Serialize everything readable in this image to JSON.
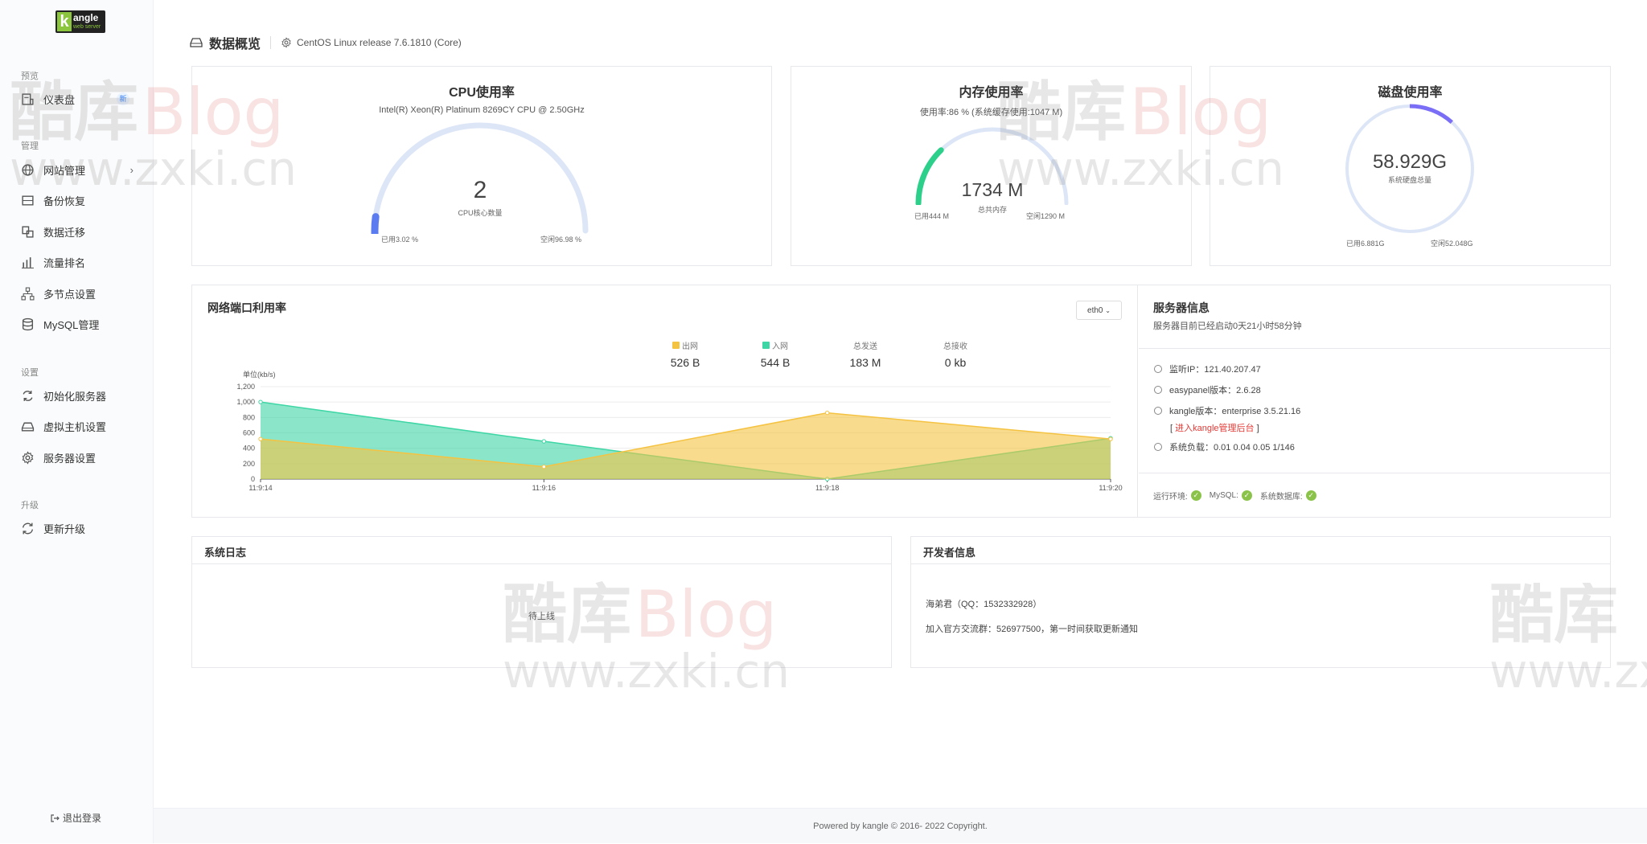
{
  "sidebar": {
    "sections": [
      {
        "title": "预览",
        "items": [
          {
            "label": "仪表盘",
            "icon": "dashboard-icon",
            "badge": "新"
          }
        ]
      },
      {
        "title": "管理",
        "items": [
          {
            "label": "网站管理",
            "icon": "globe-icon",
            "chevron": "›"
          },
          {
            "label": "备份恢复",
            "icon": "backup-icon"
          },
          {
            "label": "数据迁移",
            "icon": "migrate-icon"
          },
          {
            "label": "流量排名",
            "icon": "bar-chart-icon"
          },
          {
            "label": "多节点设置",
            "icon": "nodes-icon"
          },
          {
            "label": "MySQL管理",
            "icon": "database-icon"
          }
        ]
      },
      {
        "title": "设置",
        "items": [
          {
            "label": "初始化服务器",
            "icon": "refresh-icon"
          },
          {
            "label": "虚拟主机设置",
            "icon": "harddisk-icon"
          },
          {
            "label": "服务器设置",
            "icon": "gear-icon"
          }
        ]
      },
      {
        "title": "升级",
        "items": [
          {
            "label": "更新升级",
            "icon": "sync-icon"
          }
        ]
      }
    ],
    "logout": "退出登录",
    "logo": {
      "text": "angle",
      "letter": "k",
      "sub": "web server"
    }
  },
  "header": {
    "title": "数据概览",
    "os": "CentOS Linux release 7.6.1810 (Core)"
  },
  "cpu": {
    "title": "CPU使用率",
    "model": "Intel(R) Xeon(R) Platinum 8269CY CPU @ 2.50GHz",
    "cores": "2",
    "cores_label": "CPU核心数量",
    "used": "已用3.02 %",
    "free": "空闲96.98 %",
    "used_fraction": 0.0302
  },
  "memory": {
    "title": "内存使用率",
    "usage": "使用率:86 % (系统缓存使用:1047 M)",
    "total": "1734 M",
    "total_label": "总共内存",
    "used": "已用444 M",
    "free": "空闲1290 M",
    "used_fraction": 0.256
  },
  "disk": {
    "title": "磁盘使用率",
    "total": "58.929G",
    "total_label": "系统硬盘总量",
    "used": "已用6.881G",
    "free": "空闲52.048G",
    "used_fraction": 0.117
  },
  "network": {
    "title": "网络端口利用率",
    "interface": "eth0",
    "stats": [
      {
        "label": "出网",
        "value": "526 B",
        "color": "#f5c342"
      },
      {
        "label": "入网",
        "value": "544 B",
        "color": "#3ed6a5"
      },
      {
        "label": "总发送",
        "value": "183 M"
      },
      {
        "label": "总接收",
        "value": "0 kb"
      }
    ]
  },
  "chart_data": {
    "type": "area",
    "ylabel": "单位(kb/s)",
    "x": [
      "11:9:14",
      "11:9:16",
      "11:9:18",
      "11:9:20"
    ],
    "ylim": [
      0,
      1200
    ],
    "yticks": [
      "0",
      "200",
      "400",
      "600",
      "800",
      "1,000",
      "1,200"
    ],
    "series": [
      {
        "name": "入网",
        "values": [
          1000,
          490,
          0,
          530
        ],
        "color": "#3ed6a5"
      },
      {
        "name": "出网",
        "values": [
          520,
          160,
          860,
          520
        ],
        "color": "#f5c342"
      }
    ]
  },
  "server": {
    "title": "服务器信息",
    "uptime": "服务器目前已经启动0天21小时58分钟",
    "rows": [
      "监听IP：121.40.207.47",
      "easypanel版本：2.6.28",
      "kangle版本：enterprise 3.5.21.16",
      "系统负载：0.01 0.04 0.05 1/146"
    ],
    "kangle_link_open": "[ ",
    "kangle_link": "进入kangle管理后台",
    "kangle_link_close": " ]",
    "env_label": "运行环境:",
    "env_mysql": "MySQL:",
    "env_db": "系统数据库:",
    "check": "✓"
  },
  "syslog": {
    "title": "系统日志",
    "placeholder": "待上线"
  },
  "dev": {
    "title": "开发者信息",
    "line1": "海弟君（QQ：1532332928）",
    "line2": "加入官方交流群：526977500，第一时间获取更新通知"
  },
  "footer": "Powered by kangle © 2016- 2022 Copyright.",
  "watermark": {
    "cn": "酷库",
    "blog": "Blog",
    "url": "www.zxki.cn"
  }
}
